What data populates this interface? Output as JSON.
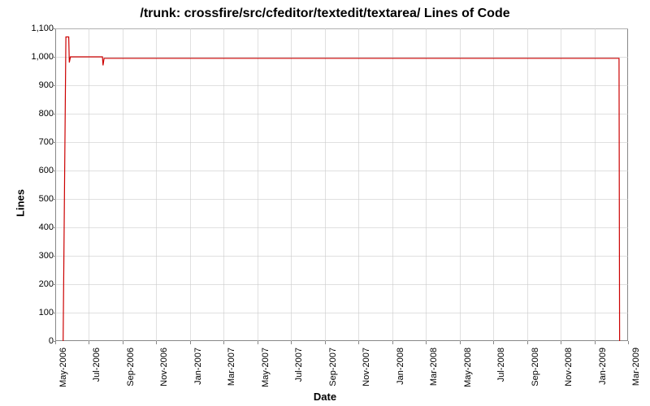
{
  "chart_data": {
    "type": "line",
    "title": "/trunk: crossfire/src/cfeditor/textedit/textarea/ Lines of Code",
    "xlabel": "Date",
    "ylabel": "Lines",
    "ylim": [
      0,
      1100
    ],
    "xlim": [
      "May-2006",
      "Mar-2009"
    ],
    "x_ticks": [
      "May-2006",
      "Jul-2006",
      "Sep-2006",
      "Nov-2006",
      "Jan-2007",
      "Mar-2007",
      "May-2007",
      "Jul-2007",
      "Sep-2007",
      "Nov-2007",
      "Jan-2008",
      "Mar-2008",
      "May-2008",
      "Jul-2008",
      "Sep-2008",
      "Nov-2008",
      "Jan-2009",
      "Mar-2009"
    ],
    "y_ticks": [
      0,
      100,
      200,
      300,
      400,
      500,
      600,
      700,
      800,
      900,
      1000,
      1100
    ],
    "series": [
      {
        "name": "Lines of Code",
        "color": "#cc0000",
        "points": [
          {
            "date": "2006-05-15",
            "value": 0
          },
          {
            "date": "2006-05-20",
            "value": 1070
          },
          {
            "date": "2006-05-25",
            "value": 1070
          },
          {
            "date": "2006-05-26",
            "value": 980
          },
          {
            "date": "2006-05-28",
            "value": 1000
          },
          {
            "date": "2006-07-25",
            "value": 1000
          },
          {
            "date": "2006-07-26",
            "value": 970
          },
          {
            "date": "2006-07-28",
            "value": 995
          },
          {
            "date": "2009-02-15",
            "value": 995
          },
          {
            "date": "2009-02-16",
            "value": 0
          }
        ]
      }
    ]
  }
}
